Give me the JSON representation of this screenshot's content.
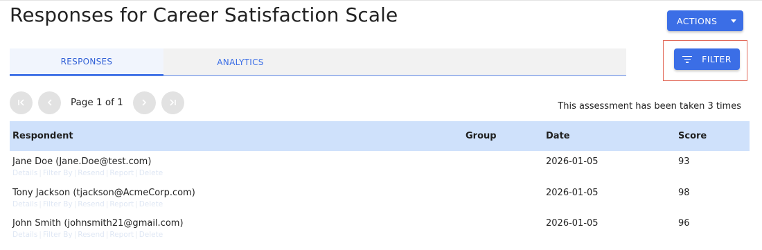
{
  "page": {
    "title": "Responses for Career Satisfaction Scale"
  },
  "actions": {
    "label": "ACTIONS"
  },
  "filter": {
    "label": "FILTER"
  },
  "tabs": [
    {
      "label": "RESPONSES",
      "active": true
    },
    {
      "label": "ANALYTICS",
      "active": false
    }
  ],
  "pagination": {
    "label": "Page 1 of 1"
  },
  "summary": {
    "text": "This assessment has been taken 3 times"
  },
  "table": {
    "headers": {
      "respondent": "Respondent",
      "group": "Group",
      "date": "Date",
      "score": "Score"
    },
    "rows": [
      {
        "respondent": "Jane Doe (Jane.Doe@test.com)",
        "group": "",
        "date": "2026-01-05",
        "score": "93"
      },
      {
        "respondent": "Tony Jackson (tjackson@AcmeCorp.com)",
        "group": "",
        "date": "2026-01-05",
        "score": "98"
      },
      {
        "respondent": "John Smith (johnsmith21@gmail.com)",
        "group": "",
        "date": "2026-01-05",
        "score": "96"
      }
    ],
    "row_links": [
      "Details",
      "Filter By",
      "Resend",
      "Report",
      "Delete"
    ]
  },
  "colors": {
    "primary": "#3b6ee6",
    "header_bg": "#cfe1fb",
    "highlight": "#e26a5a"
  },
  "icons": {
    "actions": "caret-down-icon",
    "filter": "filter-icon",
    "pager": [
      "first-page-icon",
      "previous-page-icon",
      "next-page-icon",
      "last-page-icon"
    ]
  }
}
